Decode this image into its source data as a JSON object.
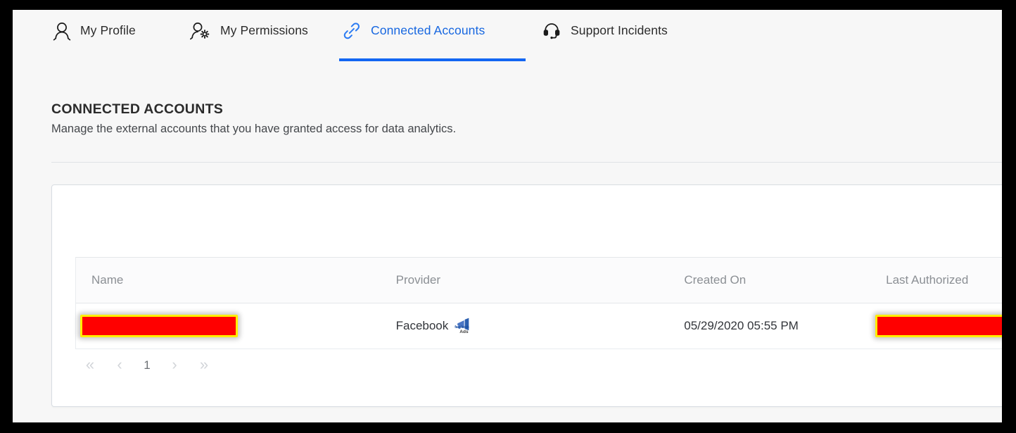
{
  "tabs": [
    {
      "label": "My Profile",
      "icon": "person-icon",
      "active": false
    },
    {
      "label": "My Permissions",
      "icon": "person-gear-icon",
      "active": false
    },
    {
      "label": "Connected Accounts",
      "icon": "link-chain-icon",
      "active": true
    },
    {
      "label": "Support Incidents",
      "icon": "headset-icon",
      "active": false
    }
  ],
  "page": {
    "title": "CONNECTED ACCOUNTS",
    "subtitle": "Manage the external accounts that you have granted access for data analytics."
  },
  "table": {
    "columns": [
      "Name",
      "Provider",
      "Created On",
      "Last Authorized"
    ],
    "rows": [
      {
        "name": "",
        "name_redacted": true,
        "provider": "Facebook",
        "provider_icon": "facebook-ads-icon",
        "created_on": "05/29/2020 05:55 PM",
        "last_authorized": "",
        "last_authorized_redacted": true
      }
    ]
  },
  "pagination": {
    "first": "«",
    "previous": "‹",
    "current_page": "1",
    "next": "›",
    "last": "»"
  },
  "colors": {
    "accent": "#1366f2",
    "active_tab_text": "#1767e0",
    "redaction_fill": "#ff0000",
    "redaction_border": "#ffee00",
    "page_background": "#f7f7f7",
    "card_background": "#ffffff"
  }
}
